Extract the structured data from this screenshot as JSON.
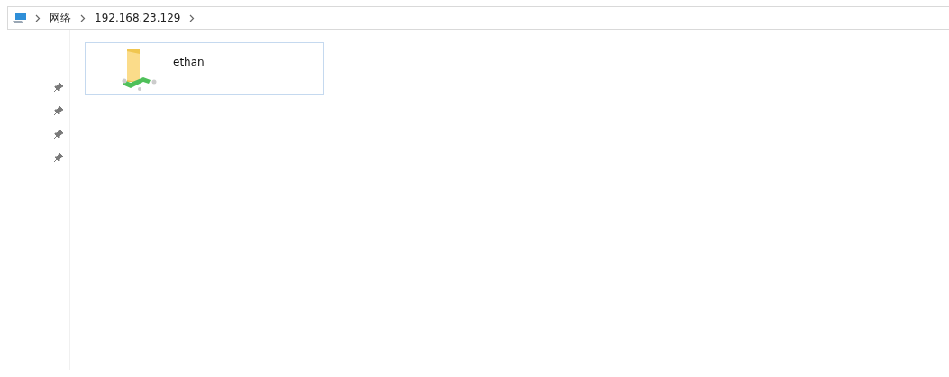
{
  "address_bar": {
    "breadcrumbs": [
      "网络",
      "192.168.23.129"
    ]
  },
  "sidebar": {
    "items": [
      {
        "pinned": true
      },
      {
        "pinned": true
      },
      {
        "pinned": true
      },
      {
        "pinned": true
      }
    ]
  },
  "items": [
    {
      "name": "ethan",
      "kind": "share",
      "selected": true
    }
  ]
}
